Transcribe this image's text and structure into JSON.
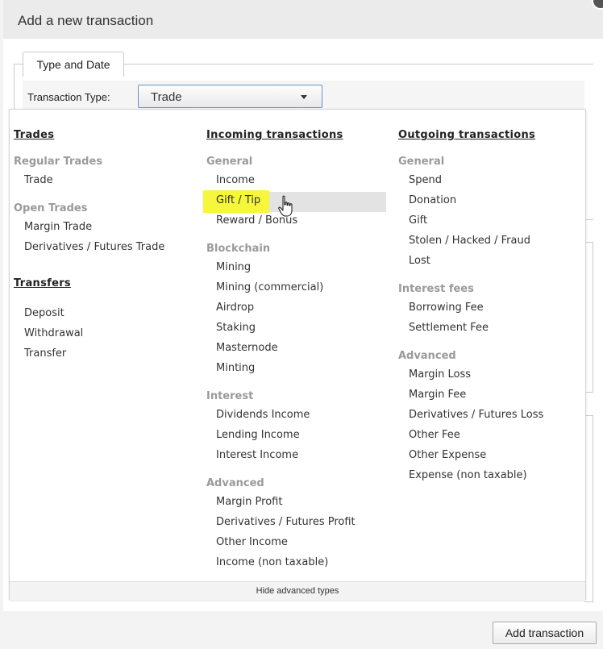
{
  "dialog": {
    "title": "Add a new transaction"
  },
  "tabs": [
    {
      "label": "Type and Date"
    }
  ],
  "type_field": {
    "label": "Transaction Type:",
    "value": "Trade"
  },
  "dropdown": {
    "columns": [
      {
        "sections": [
          {
            "heading": "Trades",
            "groups": [
              {
                "name": "Regular Trades",
                "items": [
                  "Trade"
                ]
              },
              {
                "name": "Open Trades",
                "items": [
                  "Margin Trade",
                  "Derivatives / Futures Trade"
                ]
              }
            ]
          },
          {
            "heading": "Transfers",
            "groups": [
              {
                "name": "",
                "items": [
                  "Deposit",
                  "Withdrawal",
                  "Transfer"
                ]
              }
            ]
          }
        ]
      },
      {
        "sections": [
          {
            "heading": "Incoming transactions",
            "groups": [
              {
                "name": "General",
                "items": [
                  "Income",
                  "Gift / Tip",
                  "Reward / Bonus"
                ]
              },
              {
                "name": "Blockchain",
                "items": [
                  "Mining",
                  "Mining (commercial)",
                  "Airdrop",
                  "Staking",
                  "Masternode",
                  "Minting"
                ]
              },
              {
                "name": "Interest",
                "items": [
                  "Dividends Income",
                  "Lending Income",
                  "Interest Income"
                ]
              },
              {
                "name": "Advanced",
                "items": [
                  "Margin Profit",
                  "Derivatives / Futures Profit",
                  "Other Income",
                  "Income (non taxable)"
                ]
              }
            ]
          }
        ]
      },
      {
        "sections": [
          {
            "heading": "Outgoing transactions",
            "groups": [
              {
                "name": "General",
                "items": [
                  "Spend",
                  "Donation",
                  "Gift",
                  "Stolen / Hacked / Fraud",
                  "Lost"
                ]
              },
              {
                "name": "Interest fees",
                "items": [
                  "Borrowing Fee",
                  "Settlement Fee"
                ]
              },
              {
                "name": "Advanced",
                "items": [
                  "Margin Loss",
                  "Margin Fee",
                  "Derivatives / Futures Loss",
                  "Other Fee",
                  "Other Expense",
                  "Expense (non taxable)"
                ]
              }
            ]
          }
        ]
      }
    ],
    "hovered_item": "Gift / Tip",
    "footer_label": "Hide advanced types"
  },
  "actions": {
    "add_label": "Add transaction"
  },
  "colors": {
    "highlight": "#f6f63a",
    "hover_bg": "#e3e3e3",
    "group_heading": "#9a9a9a"
  }
}
